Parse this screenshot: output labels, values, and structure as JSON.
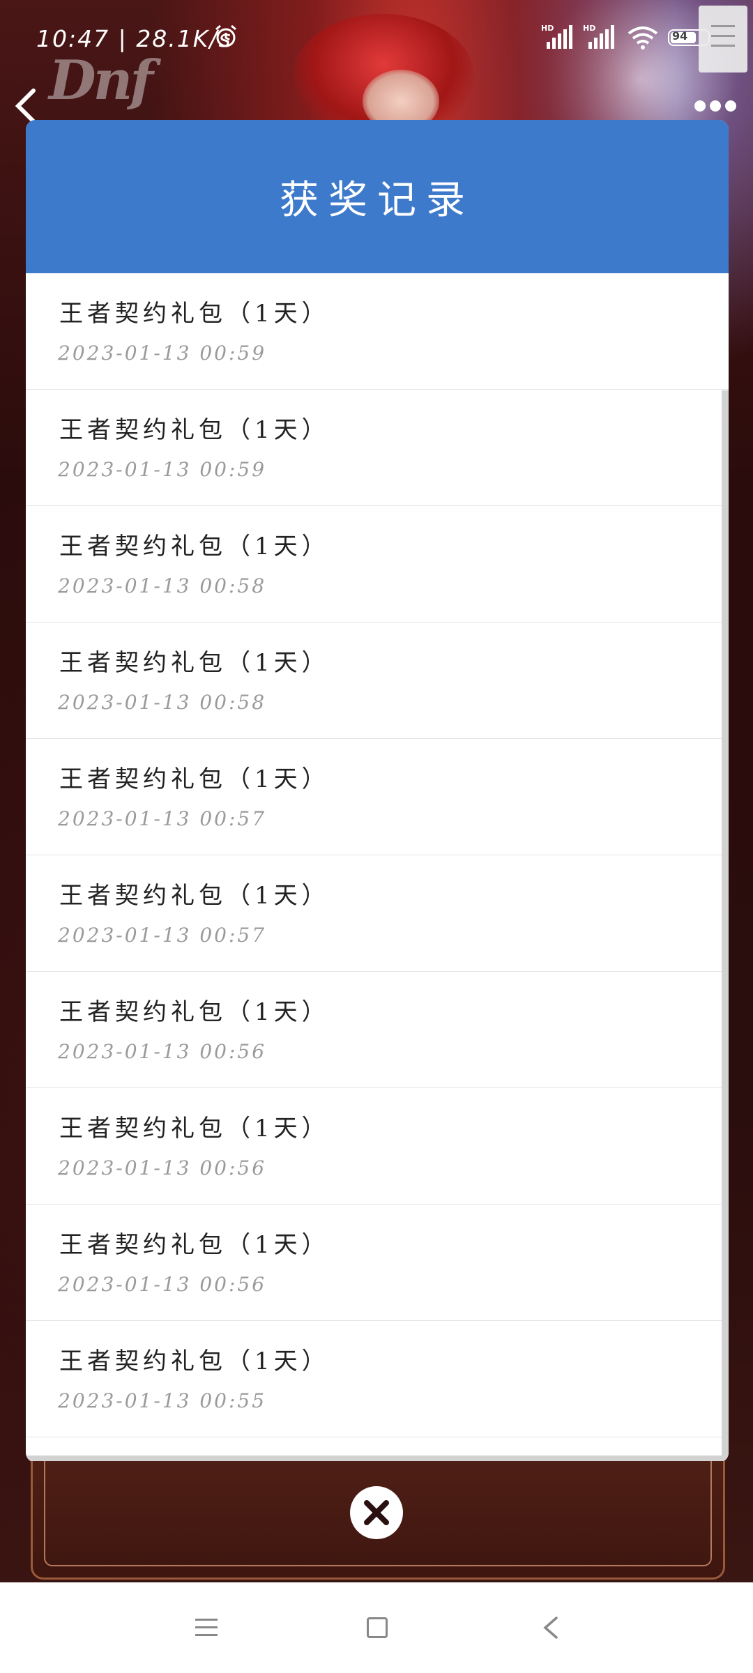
{
  "status_bar": {
    "time": "10:47",
    "speed": "28.1K/s",
    "battery_level": "94",
    "icons": [
      "alarm-icon",
      "hd-signal-icon",
      "hd-signal-icon",
      "wifi-icon",
      "battery-icon"
    ]
  },
  "nav": {
    "back_icon": "chevron-left-icon",
    "more_icon": "more-dots-icon"
  },
  "modal": {
    "title": "获奖记录",
    "header_color": "#3e7acb",
    "records": [
      {
        "name": "王者契约礼包（1天）",
        "date": "2023-01-13 00:59"
      },
      {
        "name": "王者契约礼包（1天）",
        "date": "2023-01-13 00:59"
      },
      {
        "name": "王者契约礼包（1天）",
        "date": "2023-01-13 00:58"
      },
      {
        "name": "王者契约礼包（1天）",
        "date": "2023-01-13 00:58"
      },
      {
        "name": "王者契约礼包（1天）",
        "date": "2023-01-13 00:57"
      },
      {
        "name": "王者契约礼包（1天）",
        "date": "2023-01-13 00:57"
      },
      {
        "name": "王者契约礼包（1天）",
        "date": "2023-01-13 00:56"
      },
      {
        "name": "王者契约礼包（1天）",
        "date": "2023-01-13 00:56"
      },
      {
        "name": "王者契约礼包（1天）",
        "date": "2023-01-13 00:56"
      },
      {
        "name": "王者契约礼包（1天）",
        "date": "2023-01-13 00:55"
      }
    ]
  },
  "close_icon": "close-x-icon",
  "system_nav": {
    "icons": [
      "menu-icon",
      "home-icon",
      "back-icon"
    ]
  }
}
